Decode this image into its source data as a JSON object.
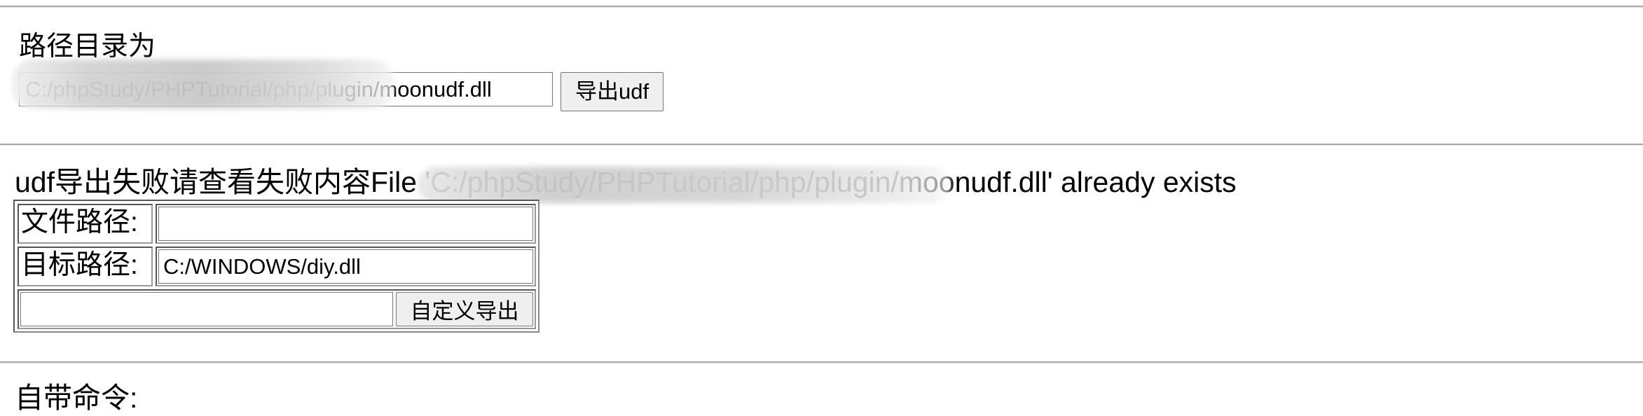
{
  "path_section": {
    "heading": "路径目录为",
    "path_value": "C:/phpStudy/PHPTutorial/php/plugin/moonudf.dll",
    "export_button_label": "导出udf"
  },
  "error": {
    "message": "udf导出失败请查看失败内容File 'C:/phpStudy/PHPTutorial/php/plugin/moonudf.dll' already exists"
  },
  "custom_export": {
    "file_path_label": "文件路径:",
    "file_path_value": "",
    "target_path_label": "目标路径:",
    "target_path_value": "C:/WINDOWS/diy.dll",
    "extra_value": "",
    "button_label": "自定义导出"
  },
  "builtin": {
    "label": "自带命令:"
  }
}
